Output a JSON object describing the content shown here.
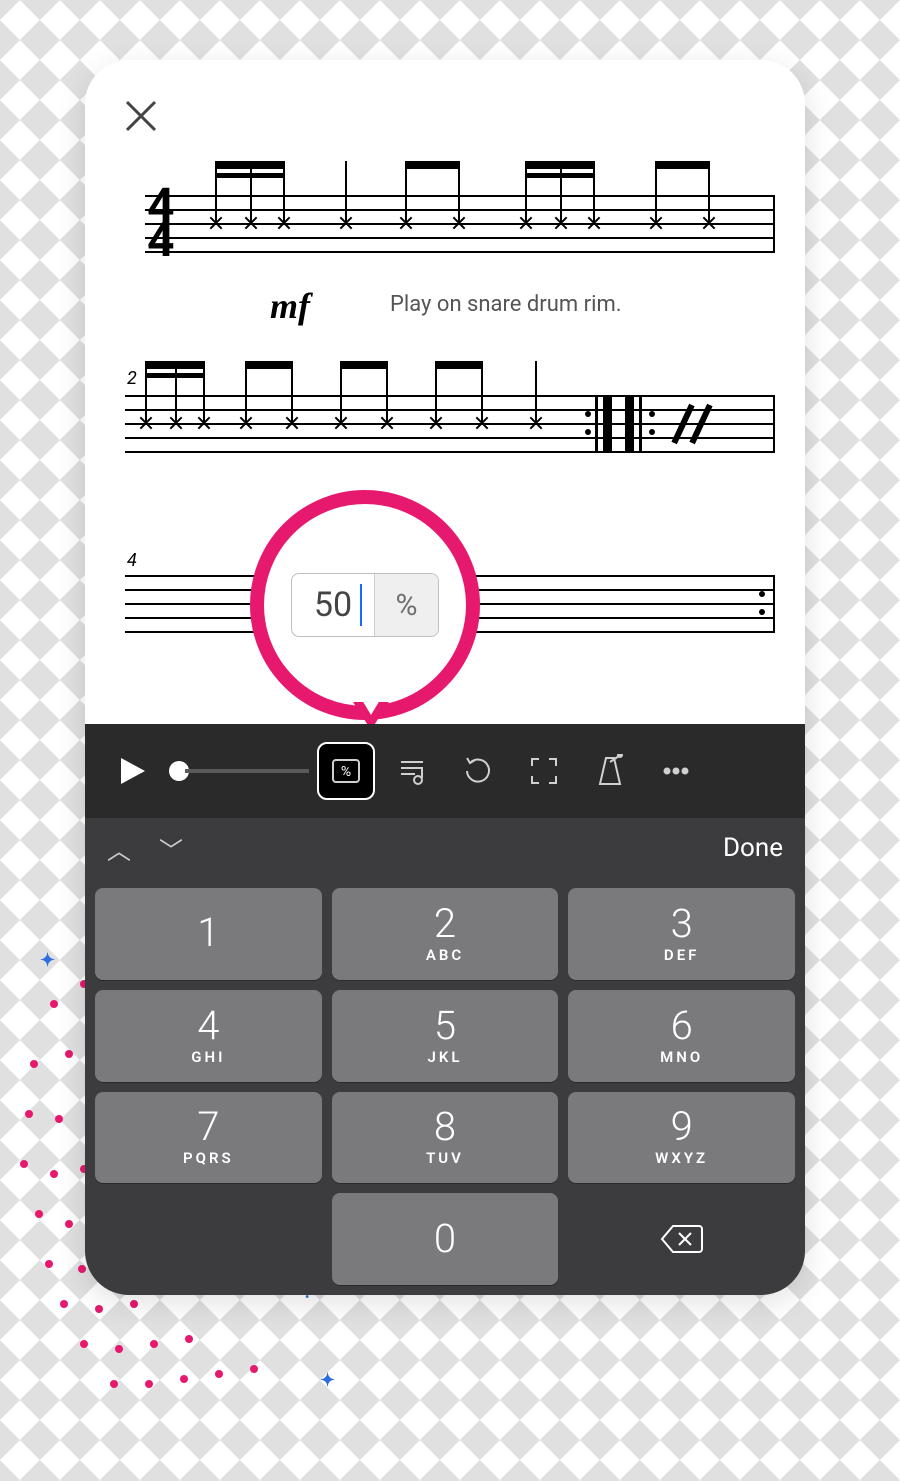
{
  "score": {
    "time_signature_top": "4",
    "time_signature_bottom": "4",
    "dynamic": "mf",
    "instruction": "Play on snare drum rim.",
    "bar2_label": "2",
    "bar4_label": "4"
  },
  "tempo_popup": {
    "value": "50",
    "unit": "%"
  },
  "accessory": {
    "done": "Done"
  },
  "keypad": {
    "k1": {
      "n": "1",
      "s": ""
    },
    "k2": {
      "n": "2",
      "s": "ABC"
    },
    "k3": {
      "n": "3",
      "s": "DEF"
    },
    "k4": {
      "n": "4",
      "s": "GHI"
    },
    "k5": {
      "n": "5",
      "s": "JKL"
    },
    "k6": {
      "n": "6",
      "s": "MNO"
    },
    "k7": {
      "n": "7",
      "s": "PQRS"
    },
    "k8": {
      "n": "8",
      "s": "TUV"
    },
    "k9": {
      "n": "9",
      "s": "WXYZ"
    },
    "k0": {
      "n": "0",
      "s": ""
    }
  }
}
